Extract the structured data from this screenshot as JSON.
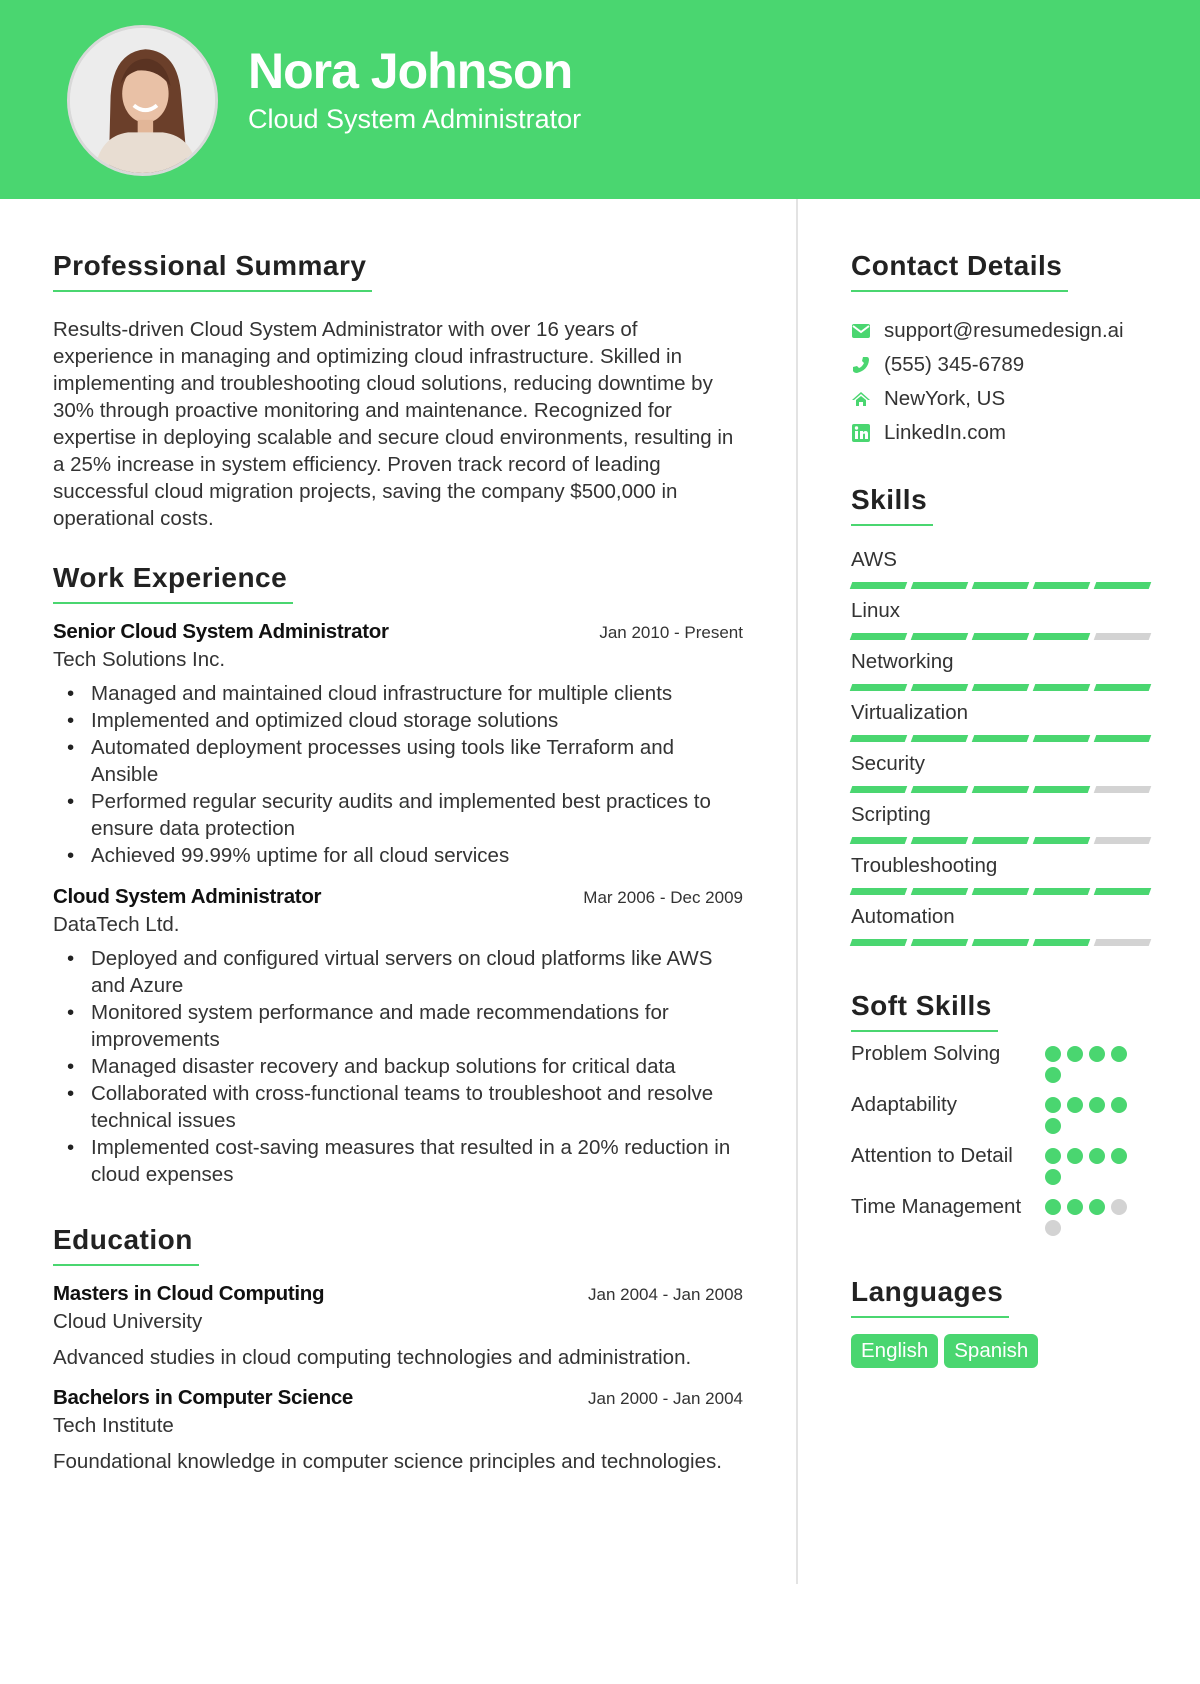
{
  "header": {
    "name": "Nora Johnson",
    "title": "Cloud System Administrator",
    "accent_color": "#4ad670"
  },
  "summary": {
    "heading": "Professional Summary",
    "text": "Results-driven Cloud System Administrator with over 16 years of experience in managing and optimizing cloud infrastructure. Skilled in implementing and troubleshooting cloud solutions, reducing downtime by 30% through proactive monitoring and maintenance. Recognized for expertise in deploying scalable and secure cloud environments, resulting in a 25% increase in system efficiency. Proven track record of leading successful cloud migration projects, saving the company $500,000 in operational costs."
  },
  "experience": {
    "heading": "Work Experience",
    "jobs": [
      {
        "title": "Senior Cloud System Administrator",
        "date": "Jan 2010 - Present",
        "company": "Tech Solutions Inc.",
        "bullets": [
          "Managed and maintained cloud infrastructure for multiple clients",
          "Implemented and optimized cloud storage solutions",
          "Automated deployment processes using tools like Terraform and Ansible",
          "Performed regular security audits and implemented best practices to ensure data protection",
          "Achieved 99.99% uptime for all cloud services"
        ]
      },
      {
        "title": "Cloud System Administrator",
        "date": "Mar 2006 - Dec 2009",
        "company": "DataTech Ltd.",
        "bullets": [
          "Deployed and configured virtual servers on cloud platforms like AWS and Azure",
          "Monitored system performance and made recommendations for improvements",
          "Managed disaster recovery and backup solutions for critical data",
          "Collaborated with cross-functional teams to troubleshoot and resolve technical issues",
          "Implemented cost-saving measures that resulted in a 20% reduction in cloud expenses"
        ]
      }
    ]
  },
  "education": {
    "heading": "Education",
    "items": [
      {
        "degree": "Masters in Cloud Computing",
        "date": "Jan 2004 - Jan 2008",
        "school": "Cloud University",
        "description": "Advanced studies in cloud computing technologies and administration."
      },
      {
        "degree": "Bachelors in Computer Science",
        "date": "Jan 2000 - Jan 2004",
        "school": "Tech Institute",
        "description": "Foundational knowledge in computer science principles and technologies."
      }
    ]
  },
  "contact": {
    "heading": "Contact Details",
    "items": [
      {
        "icon": "envelope-icon",
        "text": "support@resumedesign.ai"
      },
      {
        "icon": "phone-icon",
        "text": "(555) 345-6789"
      },
      {
        "icon": "home-icon",
        "text": "NewYork, US"
      },
      {
        "icon": "linkedin-icon",
        "text": "LinkedIn.com"
      }
    ]
  },
  "skills": {
    "heading": "Skills",
    "max": 5,
    "items": [
      {
        "name": "AWS",
        "level": 5
      },
      {
        "name": "Linux",
        "level": 4
      },
      {
        "name": "Networking",
        "level": 5
      },
      {
        "name": "Virtualization",
        "level": 5
      },
      {
        "name": "Security",
        "level": 4
      },
      {
        "name": "Scripting",
        "level": 4
      },
      {
        "name": "Troubleshooting",
        "level": 5
      },
      {
        "name": "Automation",
        "level": 4
      }
    ]
  },
  "soft_skills": {
    "heading": "Soft Skills",
    "max": 5,
    "items": [
      {
        "name": "Problem Solving",
        "level": 5
      },
      {
        "name": "Adaptability",
        "level": 5
      },
      {
        "name": "Attention to Detail",
        "level": 5
      },
      {
        "name": "Time Management",
        "level": 3
      }
    ]
  },
  "languages": {
    "heading": "Languages",
    "items": [
      "English",
      "Spanish"
    ]
  }
}
